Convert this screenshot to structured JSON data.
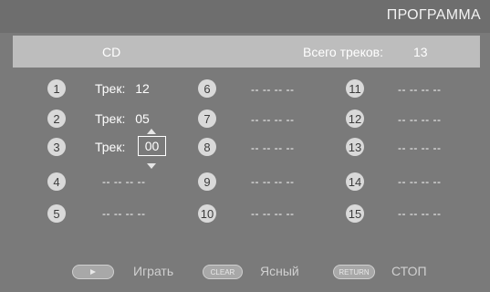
{
  "header": {
    "title": "ПРОГРАММА"
  },
  "info": {
    "disc": "CD",
    "total_label": "Всего треков:",
    "total_value": "13"
  },
  "slots": [
    {
      "num": "1",
      "label": "Трек:",
      "value": "12"
    },
    {
      "num": "2",
      "label": "Трек:",
      "value": "05"
    },
    {
      "num": "3",
      "label": "Трек:",
      "value": "00"
    },
    {
      "num": "4",
      "empty": "-- -- -- --"
    },
    {
      "num": "5",
      "empty": "-- -- -- --"
    },
    {
      "num": "6",
      "empty": "-- -- -- --"
    },
    {
      "num": "7",
      "empty": "-- -- -- --"
    },
    {
      "num": "8",
      "empty": "-- -- -- --"
    },
    {
      "num": "9",
      "empty": "-- -- -- --"
    },
    {
      "num": "10",
      "empty": "-- -- -- --"
    },
    {
      "num": "11",
      "empty": "-- -- -- --"
    },
    {
      "num": "12",
      "empty": "-- -- -- --"
    },
    {
      "num": "13",
      "empty": "-- -- -- --"
    },
    {
      "num": "14",
      "empty": "-- -- -- --"
    },
    {
      "num": "15",
      "empty": "-- -- -- --"
    }
  ],
  "footer": {
    "play_label": "Играть",
    "clear_key": "CLEAR",
    "clear_label": "Ясный",
    "return_key": "RETURN",
    "return_label": "СТОП"
  },
  "icons": {
    "play": "play-icon",
    "edit_up": "arrow-up-icon",
    "edit_down": "arrow-down-icon"
  }
}
